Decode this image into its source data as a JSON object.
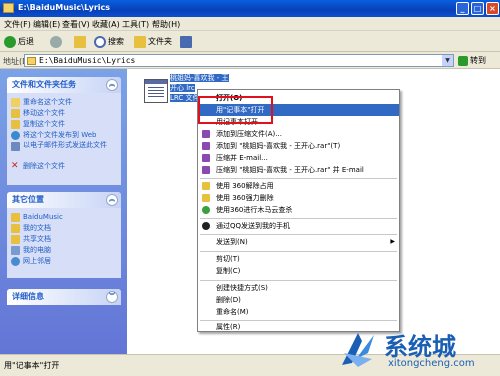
{
  "window": {
    "title": "E:\\BaiduMusic\\Lyrics",
    "min": "_",
    "max": "□",
    "close": "×"
  },
  "menu": [
    "文件(F)",
    "编辑(E)",
    "查看(V)",
    "收藏(A)",
    "工具(T)",
    "帮助(H)"
  ],
  "toolbar": {
    "back": "后退",
    "search": "搜索",
    "folders": "文件夹"
  },
  "address": {
    "label": "地址(D)",
    "path": "E:\\BaiduMusic\\Lyrics",
    "go": "转到"
  },
  "tasks": {
    "title": "文件和文件夹任务",
    "items": [
      "重命名这个文件",
      "移动这个文件",
      "复制这个文件",
      "将这个文件发布到 Web",
      "以电子邮件形式发送此文件",
      "删除这个文件"
    ]
  },
  "places": {
    "title": "其它位置",
    "items": [
      "BaiduMusic",
      "我的文档",
      "共享文档",
      "我的电脑",
      "网上邻居"
    ]
  },
  "details": {
    "title": "详细信息"
  },
  "file": {
    "line1": "桃姐妈-喜欢我 - 王",
    "line2": "开心 lrc",
    "line3": "LRC 文件"
  },
  "context_menu": [
    "打开(O)",
    "用\"记事本\"打开",
    "用记事本打开",
    "添加到压缩文件(A)...",
    "添加到 \"桃姐妈-喜欢我 - 王开心.rar\"(T)",
    "压缩并 E-mail...",
    "压缩到 \"桃姐妈-喜欢我 - 王开心.rar\" 并 E-mail",
    "使用 360解除占用",
    "使用 360强力删除",
    "使用360进行木马云查杀",
    "通过QQ发送到我的手机",
    "发送到(N)",
    "剪切(T)",
    "复制(C)",
    "创建快捷方式(S)",
    "删除(D)",
    "重命名(M)",
    "属性(R)"
  ],
  "status": "用\"记事本\"打开",
  "watermark": {
    "title": "系统城",
    "url": "xitongcheng.com"
  },
  "colors": {
    "titlebar": "#0a4fd0",
    "highlight": "#316ac5",
    "annotation": "#e0101c",
    "taskpane": "#6375d6"
  }
}
